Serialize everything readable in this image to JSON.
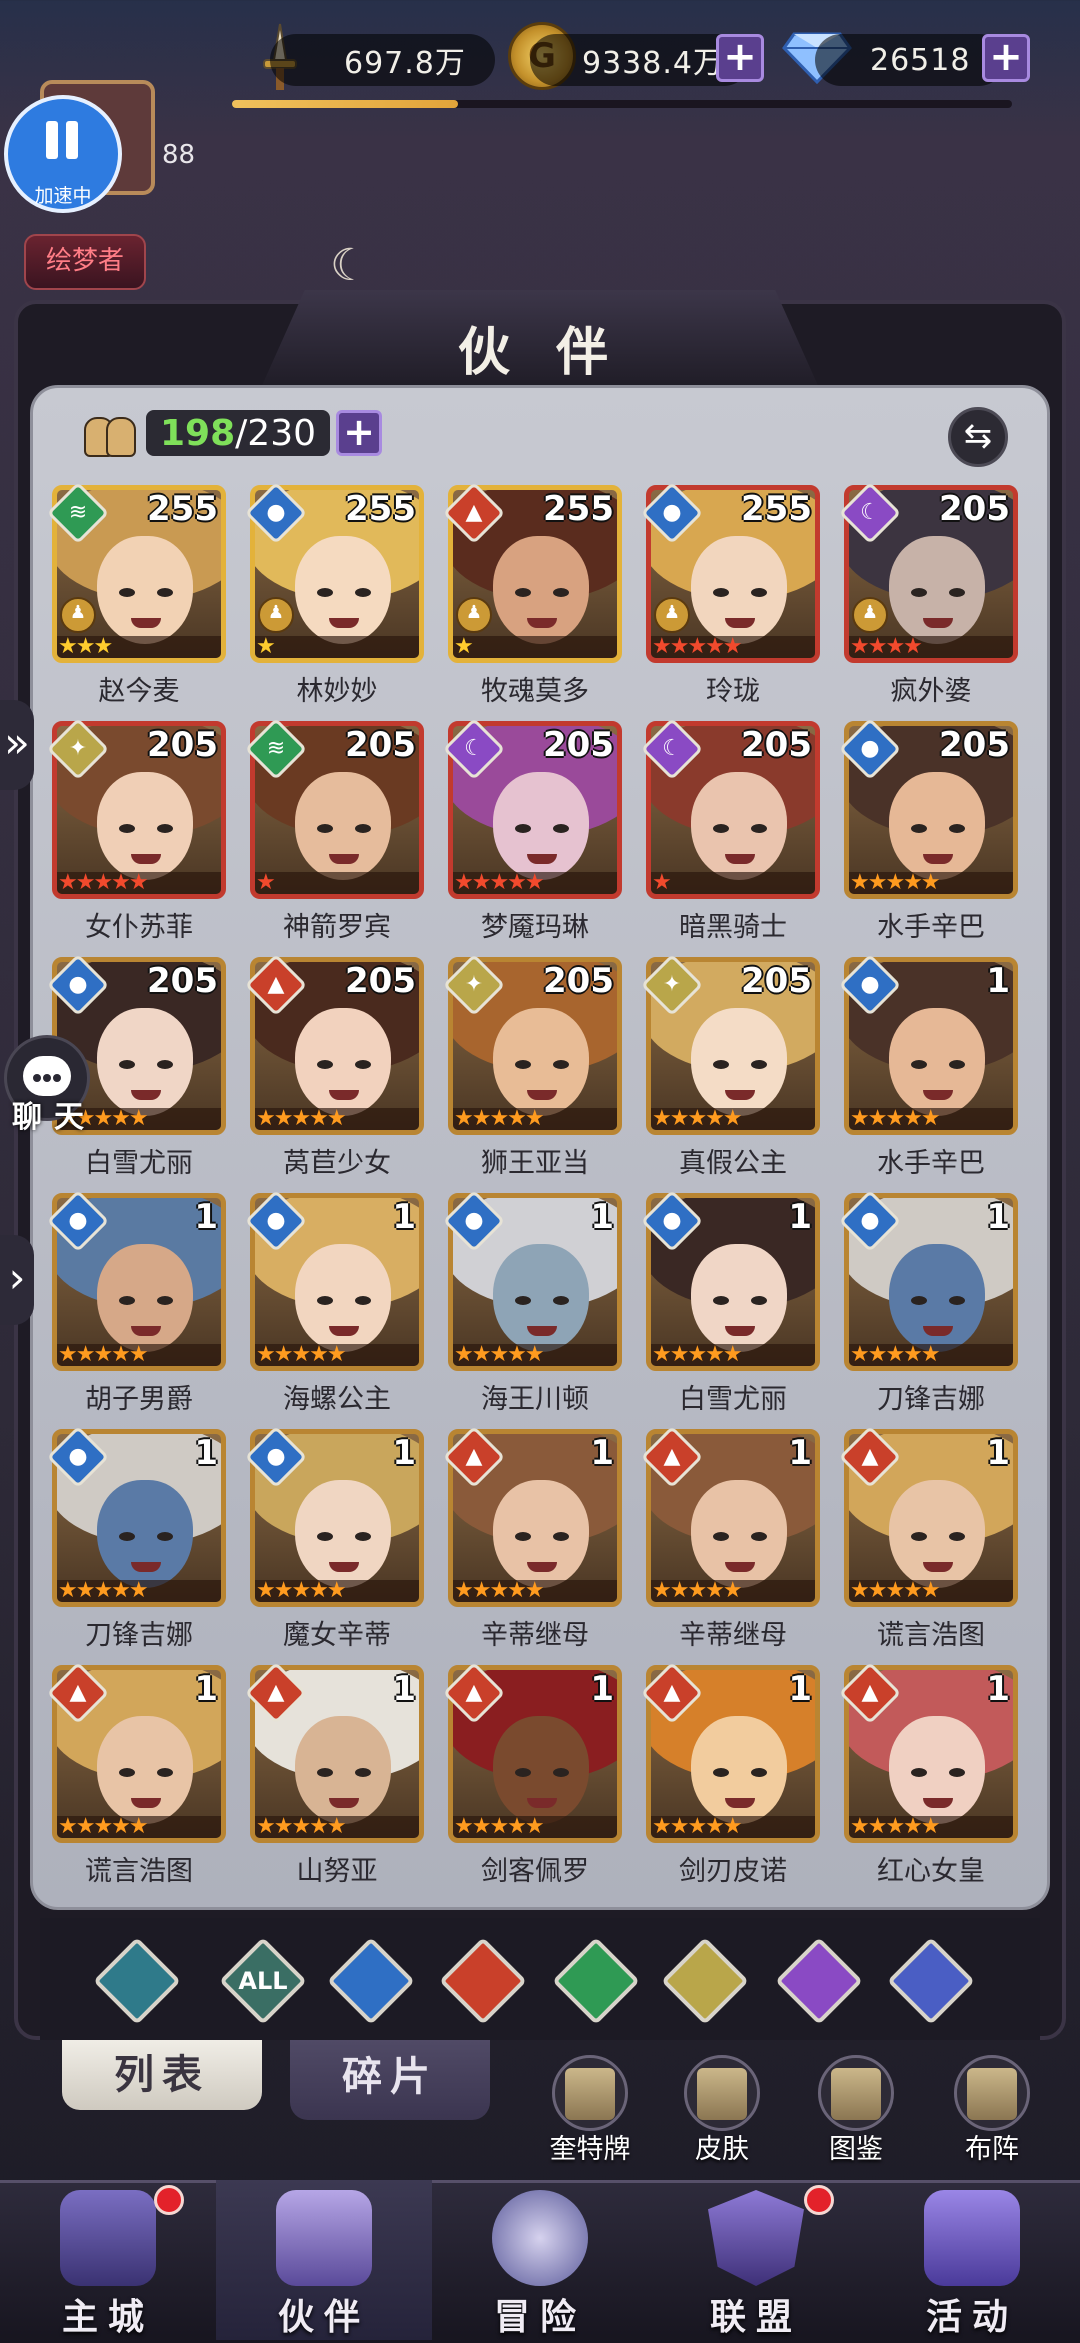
{
  "resources": {
    "power": "697.8万",
    "gold": "9338.4万",
    "gems": "26518",
    "xp_fraction": 0.29
  },
  "player": {
    "level": "88",
    "speed_label": "加速中",
    "title": "绘梦者"
  },
  "panel": {
    "title": "伙 伴",
    "count_have": "198",
    "count_max": "/230"
  },
  "heroes": [
    {
      "name": "赵今麦",
      "level": "255",
      "element": "wind",
      "stars": 3,
      "star_color": "gold",
      "frame": "gold",
      "pawn": true,
      "hair": "#c99a52",
      "skin": "#f2d2b4"
    },
    {
      "name": "林妙妙",
      "level": "255",
      "element": "water",
      "stars": 1,
      "star_color": "gold",
      "frame": "gold",
      "pawn": true,
      "hair": "#e1b95a",
      "skin": "#f5dac0"
    },
    {
      "name": "牧魂莫多",
      "level": "255",
      "element": "fire",
      "stars": 1,
      "star_color": "gold",
      "frame": "gold",
      "pawn": true,
      "hair": "#5a2c1e",
      "skin": "#d8a280"
    },
    {
      "name": "玲珑",
      "level": "255",
      "element": "water",
      "stars": 5,
      "star_color": "red",
      "frame": "red",
      "pawn": true,
      "hair": "#d8a750",
      "skin": "#f2d6be"
    },
    {
      "name": "疯外婆",
      "level": "205",
      "element": "dark",
      "stars": 4,
      "star_color": "red",
      "frame": "red",
      "pawn": true,
      "hair": "#3c3440",
      "skin": "#c7b2a8"
    },
    {
      "name": "女仆苏菲",
      "level": "205",
      "element": "light",
      "stars": 5,
      "star_color": "red",
      "frame": "red",
      "pawn": false,
      "hair": "#7a4a2e",
      "skin": "#f0cfb6"
    },
    {
      "name": "神箭罗宾",
      "level": "205",
      "element": "wind",
      "stars": 1,
      "star_color": "red",
      "frame": "red",
      "pawn": false,
      "hair": "#6a3a22",
      "skin": "#e6bc9c"
    },
    {
      "name": "梦魇玛琳",
      "level": "205",
      "element": "dark",
      "stars": 5,
      "star_color": "red",
      "frame": "red",
      "pawn": false,
      "hair": "#9a4a9a",
      "skin": "#e6c2d0"
    },
    {
      "name": "暗黑骑士",
      "level": "205",
      "element": "dark",
      "stars": 1,
      "star_color": "red",
      "frame": "red",
      "pawn": false,
      "hair": "#8a3a2c",
      "skin": "#eac4ae"
    },
    {
      "name": "水手辛巴",
      "level": "205",
      "element": "water",
      "stars": 5,
      "star_color": "orange",
      "frame": "orange",
      "pawn": false,
      "hair": "#4a3228",
      "skin": "#e6b896"
    },
    {
      "name": "白雪尤丽",
      "level": "205",
      "element": "water",
      "stars": 5,
      "star_color": "orange",
      "frame": "orange",
      "pawn": false,
      "hair": "#3a2824",
      "skin": "#f0d6c6"
    },
    {
      "name": "莴苣少女",
      "level": "205",
      "element": "fire",
      "stars": 5,
      "star_color": "orange",
      "frame": "orange",
      "pawn": false,
      "hair": "#4a2a1e",
      "skin": "#f2d2be"
    },
    {
      "name": "狮王亚当",
      "level": "205",
      "element": "light",
      "stars": 5,
      "star_color": "orange",
      "frame": "orange",
      "pawn": false,
      "hair": "#a8652e",
      "skin": "#e8bc96"
    },
    {
      "name": "真假公主",
      "level": "205",
      "element": "light",
      "stars": 5,
      "star_color": "orange",
      "frame": "orange",
      "pawn": false,
      "hair": "#d2aa60",
      "skin": "#f4dcc6"
    },
    {
      "name": "水手辛巴",
      "level": "1",
      "element": "water",
      "stars": 5,
      "star_color": "orange",
      "frame": "orange",
      "pawn": false,
      "hair": "#4a3228",
      "skin": "#e6b896"
    },
    {
      "name": "胡子男爵",
      "level": "1",
      "element": "water",
      "stars": 5,
      "star_color": "orange",
      "frame": "orange",
      "pawn": false,
      "hair": "#5a7aa2",
      "skin": "#d6a888"
    },
    {
      "name": "海螺公主",
      "level": "1",
      "element": "water",
      "stars": 5,
      "star_color": "orange",
      "frame": "orange",
      "pawn": false,
      "hair": "#d8ae62",
      "skin": "#f2d6c0"
    },
    {
      "name": "海王川顿",
      "level": "1",
      "element": "water",
      "stars": 5,
      "star_color": "orange",
      "frame": "orange",
      "pawn": false,
      "hair": "#d0d0d4",
      "skin": "#8ea4b6"
    },
    {
      "name": "白雪尤丽",
      "level": "1",
      "element": "water",
      "stars": 5,
      "star_color": "orange",
      "frame": "orange",
      "pawn": false,
      "hair": "#3a2824",
      "skin": "#f0d6c6"
    },
    {
      "name": "刀锋吉娜",
      "level": "1",
      "element": "water",
      "stars": 5,
      "star_color": "orange",
      "frame": "orange",
      "pawn": false,
      "hair": "#cfcac4",
      "skin": "#5a7aa6"
    },
    {
      "name": "刀锋吉娜",
      "level": "1",
      "element": "water",
      "stars": 5,
      "star_color": "orange",
      "frame": "orange",
      "pawn": false,
      "hair": "#cfcac4",
      "skin": "#5a7aa6"
    },
    {
      "name": "魔女辛蒂",
      "level": "1",
      "element": "water",
      "stars": 5,
      "star_color": "orange",
      "frame": "orange",
      "pawn": false,
      "hair": "#c9a65c",
      "skin": "#f0d6c2"
    },
    {
      "name": "辛蒂继母",
      "level": "1",
      "element": "fire",
      "stars": 5,
      "star_color": "orange",
      "frame": "orange",
      "pawn": false,
      "hair": "#8a5a3a",
      "skin": "#e8c2a6"
    },
    {
      "name": "辛蒂继母",
      "level": "1",
      "element": "fire",
      "stars": 5,
      "star_color": "orange",
      "frame": "orange",
      "pawn": false,
      "hair": "#8a5a3a",
      "skin": "#e8c2a6"
    },
    {
      "name": "谎言浩图",
      "level": "1",
      "element": "fire",
      "stars": 5,
      "star_color": "orange",
      "frame": "orange",
      "pawn": false,
      "hair": "#d2a65a",
      "skin": "#e8c4a6"
    },
    {
      "name": "谎言浩图",
      "level": "1",
      "element": "fire",
      "stars": 5,
      "star_color": "orange",
      "frame": "orange",
      "pawn": false,
      "hair": "#d2a65a",
      "skin": "#e8c4a6"
    },
    {
      "name": "山努亚",
      "level": "1",
      "element": "fire",
      "stars": 5,
      "star_color": "orange",
      "frame": "orange",
      "pawn": false,
      "hair": "#e6e2da",
      "skin": "#d8b494"
    },
    {
      "name": "剑客佩罗",
      "level": "1",
      "element": "fire",
      "stars": 5,
      "star_color": "orange",
      "frame": "orange",
      "pawn": false,
      "hair": "#8a1e20",
      "skin": "#7a4a2e"
    },
    {
      "name": "剑刃皮诺",
      "level": "1",
      "element": "fire",
      "stars": 5,
      "star_color": "orange",
      "frame": "orange",
      "pawn": false,
      "hair": "#d6802a",
      "skin": "#f2cc9e"
    },
    {
      "name": "红心女皇",
      "level": "1",
      "element": "fire",
      "stars": 5,
      "star_color": "orange",
      "frame": "orange",
      "pawn": false,
      "hair": "#c25a5a",
      "skin": "#f0d0c2"
    }
  ],
  "element_colors": {
    "wind": "#2f9a54",
    "water": "#2f6fc4",
    "fire": "#c9402a",
    "light": "#b9a64a",
    "dark": "#8a4ac4",
    "all": "#3a6e64"
  },
  "filters": [
    {
      "id": "rank",
      "label": "",
      "color": "#2f7a8a"
    },
    {
      "id": "all",
      "label": "ALL",
      "color": "#3a6e64"
    },
    {
      "id": "water",
      "label": "",
      "color": "#2f6fc4"
    },
    {
      "id": "fire",
      "label": "",
      "color": "#c9402a"
    },
    {
      "id": "wind",
      "label": "",
      "color": "#2f9a54"
    },
    {
      "id": "light",
      "label": "",
      "color": "#b9a64a"
    },
    {
      "id": "dark",
      "label": "",
      "color": "#8a4ac4"
    },
    {
      "id": "cosmos",
      "label": "",
      "color": "#4a5ec4"
    }
  ],
  "tabs": {
    "list": "列表",
    "fragments": "碎片"
  },
  "quick": [
    "奎特牌",
    "皮肤",
    "图鉴",
    "布阵"
  ],
  "nav": [
    "主城",
    "伙伴",
    "冒险",
    "联盟",
    "活动"
  ],
  "chat": "聊天"
}
